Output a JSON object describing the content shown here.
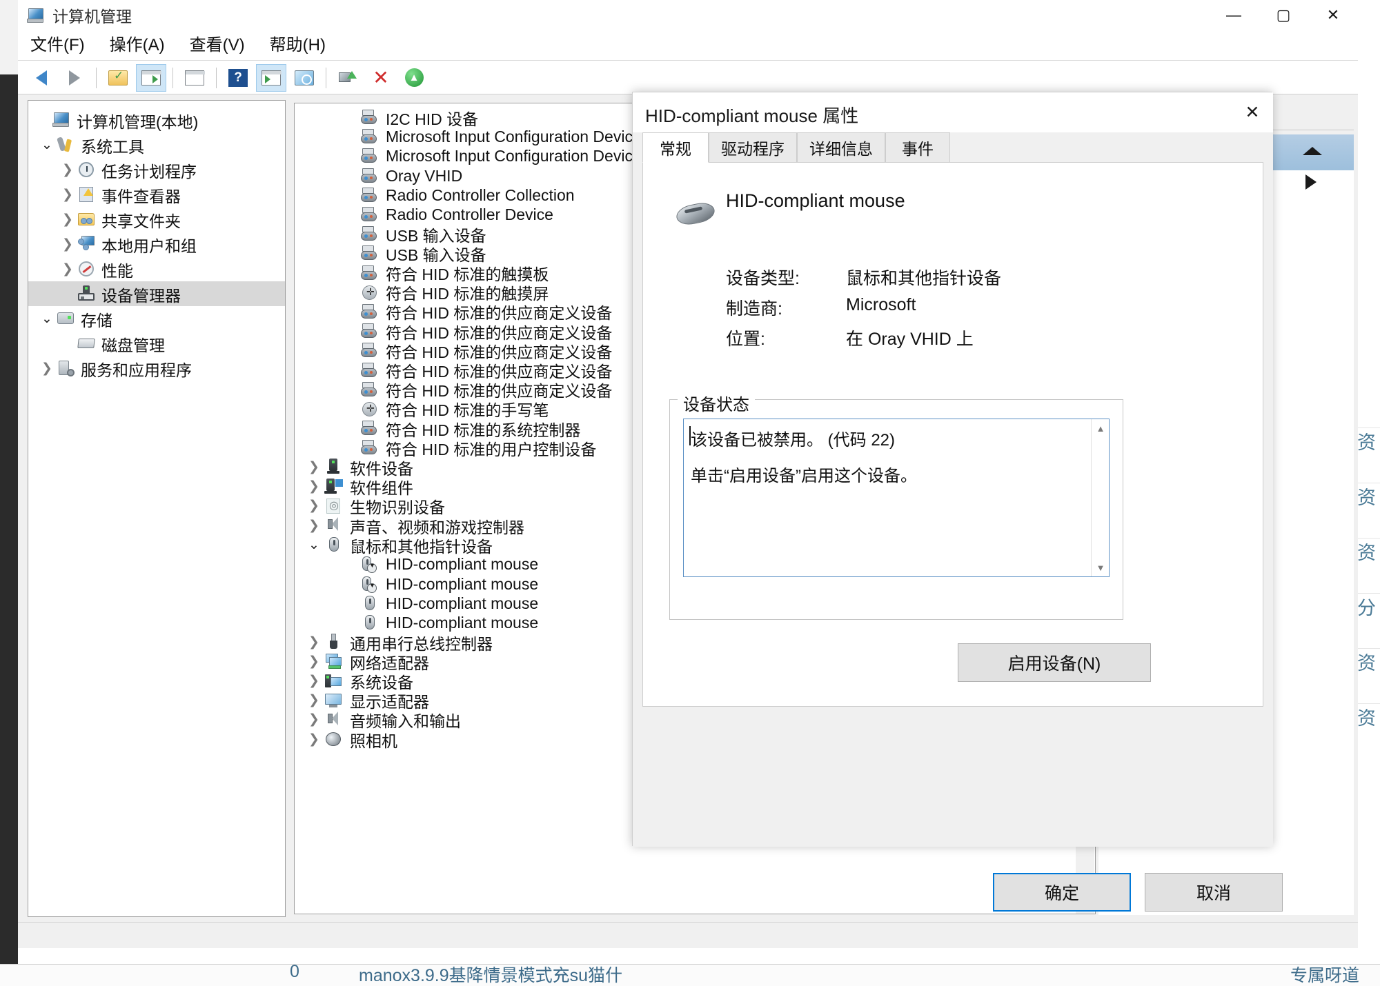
{
  "window": {
    "title": "计算机管理",
    "title_icon": "computer-management-icon",
    "caption": {
      "minimize": "—",
      "maximize": "▢",
      "close": "✕"
    }
  },
  "menubar": {
    "items": [
      {
        "label": "文件(F)",
        "name": "menu-file"
      },
      {
        "label": "操作(A)",
        "name": "menu-action"
      },
      {
        "label": "查看(V)",
        "name": "menu-view"
      },
      {
        "label": "帮助(H)",
        "name": "menu-help"
      }
    ]
  },
  "toolbar": {
    "buttons": [
      {
        "name": "back-button",
        "icon": "back-arrow-icon",
        "active": false
      },
      {
        "name": "forward-button",
        "icon": "forward-arrow-icon",
        "active": false
      },
      {
        "name": "up-folder-button",
        "icon": "folder-up-icon",
        "active": false
      },
      {
        "name": "show-hide-tree-button",
        "icon": "tree-pane-icon",
        "active": true
      },
      {
        "name": "properties-button",
        "icon": "properties-list-icon",
        "active": false
      },
      {
        "name": "help-button",
        "icon": "question-mark-icon",
        "active": false
      },
      {
        "name": "console-tree-button",
        "icon": "console-pane-icon",
        "active": true
      },
      {
        "name": "scan-hardware-button",
        "icon": "monitor-search-icon",
        "active": false
      },
      {
        "name": "update-driver-button",
        "icon": "update-driver-icon",
        "active": false
      },
      {
        "name": "uninstall-device-button",
        "icon": "red-x-icon",
        "active": false
      },
      {
        "name": "enable-device-button",
        "icon": "green-up-circle-icon",
        "active": false
      }
    ]
  },
  "tree": {
    "items": [
      {
        "label": "计算机管理(本地)",
        "indent": 0,
        "twisty": "none",
        "icon": "computer-icon",
        "selected": false
      },
      {
        "label": "系统工具",
        "indent": 1,
        "twisty": "open",
        "icon": "system-tools-icon",
        "selected": false
      },
      {
        "label": "任务计划程序",
        "indent": 2,
        "twisty": "closed",
        "icon": "task-scheduler-icon",
        "selected": false
      },
      {
        "label": "事件查看器",
        "indent": 2,
        "twisty": "closed",
        "icon": "event-viewer-icon",
        "selected": false
      },
      {
        "label": "共享文件夹",
        "indent": 2,
        "twisty": "closed",
        "icon": "shared-folders-icon",
        "selected": false
      },
      {
        "label": "本地用户和组",
        "indent": 2,
        "twisty": "closed",
        "icon": "local-users-icon",
        "selected": false
      },
      {
        "label": "性能",
        "indent": 2,
        "twisty": "closed",
        "icon": "performance-icon",
        "selected": false
      },
      {
        "label": "设备管理器",
        "indent": 2,
        "twisty": "none",
        "icon": "device-manager-icon",
        "selected": true
      },
      {
        "label": "存储",
        "indent": 1,
        "twisty": "open",
        "icon": "storage-icon",
        "selected": false
      },
      {
        "label": "磁盘管理",
        "indent": 2,
        "twisty": "none",
        "icon": "disk-management-icon",
        "selected": false
      },
      {
        "label": "服务和应用程序",
        "indent": 1,
        "twisty": "closed",
        "icon": "services-apps-icon",
        "selected": false
      }
    ]
  },
  "device_list": {
    "items": [
      {
        "label": "I2C HID 设备",
        "indent": 2,
        "twisty": "none",
        "icon": "hid-device-icon"
      },
      {
        "label": "Microsoft Input Configuration Device",
        "indent": 2,
        "twisty": "none",
        "icon": "hid-device-icon"
      },
      {
        "label": "Microsoft Input Configuration Device",
        "indent": 2,
        "twisty": "none",
        "icon": "hid-device-icon"
      },
      {
        "label": "Oray VHID",
        "indent": 2,
        "twisty": "none",
        "icon": "hid-device-icon"
      },
      {
        "label": "Radio Controller Collection",
        "indent": 2,
        "twisty": "none",
        "icon": "hid-device-icon"
      },
      {
        "label": "Radio Controller Device",
        "indent": 2,
        "twisty": "none",
        "icon": "hid-device-icon"
      },
      {
        "label": "USB 输入设备",
        "indent": 2,
        "twisty": "none",
        "icon": "hid-device-icon"
      },
      {
        "label": "USB 输入设备",
        "indent": 2,
        "twisty": "none",
        "icon": "hid-device-icon"
      },
      {
        "label": "符合 HID 标准的触摸板",
        "indent": 2,
        "twisty": "none",
        "icon": "hid-device-icon"
      },
      {
        "label": "符合 HID 标准的触摸屏",
        "indent": 2,
        "twisty": "none",
        "icon": "hid-touch-icon"
      },
      {
        "label": "符合 HID 标准的供应商定义设备",
        "indent": 2,
        "twisty": "none",
        "icon": "hid-device-icon"
      },
      {
        "label": "符合 HID 标准的供应商定义设备",
        "indent": 2,
        "twisty": "none",
        "icon": "hid-device-icon"
      },
      {
        "label": "符合 HID 标准的供应商定义设备",
        "indent": 2,
        "twisty": "none",
        "icon": "hid-device-icon"
      },
      {
        "label": "符合 HID 标准的供应商定义设备",
        "indent": 2,
        "twisty": "none",
        "icon": "hid-device-icon"
      },
      {
        "label": "符合 HID 标准的供应商定义设备",
        "indent": 2,
        "twisty": "none",
        "icon": "hid-device-icon"
      },
      {
        "label": "符合 HID 标准的手写笔",
        "indent": 2,
        "twisty": "none",
        "icon": "hid-touch-icon"
      },
      {
        "label": "符合 HID 标准的系统控制器",
        "indent": 2,
        "twisty": "none",
        "icon": "hid-device-icon"
      },
      {
        "label": "符合 HID 标准的用户控制设备",
        "indent": 2,
        "twisty": "none",
        "icon": "hid-device-icon"
      },
      {
        "label": "软件设备",
        "indent": 1,
        "twisty": "closed",
        "icon": "software-device-icon"
      },
      {
        "label": "软件组件",
        "indent": 1,
        "twisty": "closed",
        "icon": "software-component-icon"
      },
      {
        "label": "生物识别设备",
        "indent": 1,
        "twisty": "closed",
        "icon": "biometric-icon"
      },
      {
        "label": "声音、视频和游戏控制器",
        "indent": 1,
        "twisty": "closed",
        "icon": "sound-video-icon"
      },
      {
        "label": "鼠标和其他指针设备",
        "indent": 1,
        "twisty": "open",
        "icon": "mouse-icon"
      },
      {
        "label": "HID-compliant mouse",
        "indent": 2,
        "twisty": "none",
        "icon": "mouse-disabled-icon"
      },
      {
        "label": "HID-compliant mouse",
        "indent": 2,
        "twisty": "none",
        "icon": "mouse-disabled-icon"
      },
      {
        "label": "HID-compliant mouse",
        "indent": 2,
        "twisty": "none",
        "icon": "mouse-icon"
      },
      {
        "label": "HID-compliant mouse",
        "indent": 2,
        "twisty": "none",
        "icon": "mouse-icon"
      },
      {
        "label": "通用串行总线控制器",
        "indent": 1,
        "twisty": "closed",
        "icon": "usb-controller-icon"
      },
      {
        "label": "网络适配器",
        "indent": 1,
        "twisty": "closed",
        "icon": "network-adapter-icon"
      },
      {
        "label": "系统设备",
        "indent": 1,
        "twisty": "closed",
        "icon": "system-device-icon"
      },
      {
        "label": "显示适配器",
        "indent": 1,
        "twisty": "closed",
        "icon": "display-adapter-icon"
      },
      {
        "label": "音频输入和输出",
        "indent": 1,
        "twisty": "closed",
        "icon": "audio-io-icon"
      },
      {
        "label": "照相机",
        "indent": 1,
        "twisty": "closed",
        "icon": "camera-icon"
      }
    ]
  },
  "dialog": {
    "title": "HID-compliant mouse 属性",
    "close_glyph": "✕",
    "tabs": [
      {
        "label": "常规",
        "name": "tab-general",
        "active": true
      },
      {
        "label": "驱动程序",
        "name": "tab-driver",
        "active": false
      },
      {
        "label": "详细信息",
        "name": "tab-details",
        "active": false
      },
      {
        "label": "事件",
        "name": "tab-events",
        "active": false
      }
    ],
    "device_name": "HID-compliant mouse",
    "device_icon": "mouse-hero-icon",
    "info": [
      {
        "label": "设备类型:",
        "value": "鼠标和其他指针设备"
      },
      {
        "label": "制造商:",
        "value": "Microsoft"
      },
      {
        "label": "位置:",
        "value": "在 Oray VHID 上"
      }
    ],
    "status_group_label": "设备状态",
    "status_line_1": "该设备已被禁用。 (代码 22)",
    "status_line_2": "单击“启用设备”启用这个设备。",
    "enable_button": "启用设备(N)",
    "ok_button": "确定",
    "cancel_button": "取消"
  },
  "background": {
    "right_labels": [
      "资",
      "资",
      "资",
      "分",
      "资",
      "资"
    ],
    "taskbar_number": "0",
    "taskbar_text": "manox3.9.9基降情景模式充su猫什",
    "taskbar_right": "专属呀道"
  },
  "colors": {
    "accent": "#0078d7",
    "selection": "#d8d8d8",
    "toolbar_active": "#cfe6f7",
    "status_border": "#5a8fc4"
  }
}
